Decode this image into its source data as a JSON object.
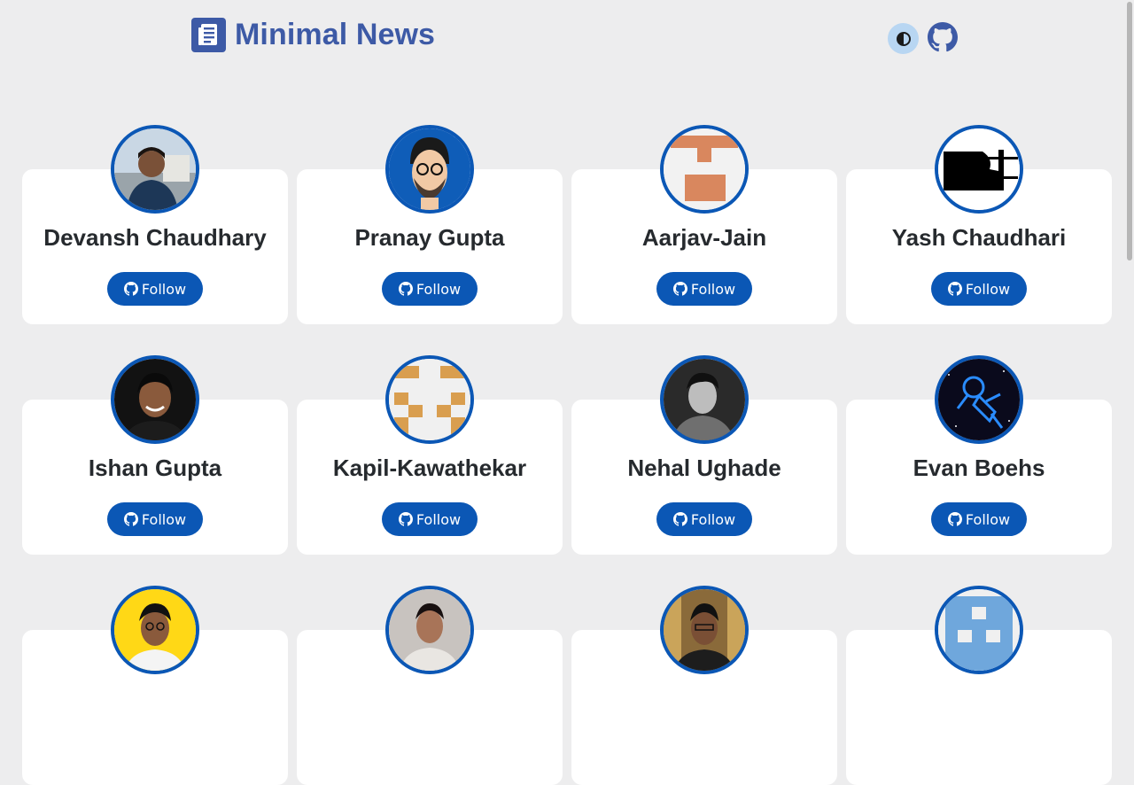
{
  "header": {
    "title": "Minimal News",
    "logo_icon": "newspaper-icon",
    "theme_toggle_icon": "contrast-icon",
    "github_icon": "github-icon"
  },
  "colors": {
    "brand": "#3d5aa6",
    "button": "#0b57b5",
    "avatar_border": "#0b57b5",
    "background": "#ededee",
    "card": "#ffffff",
    "name_text": "#262a2e"
  },
  "contributors": [
    {
      "name": "Devansh Chaudhary",
      "button_label": "Follow"
    },
    {
      "name": "Pranay Gupta",
      "button_label": "Follow"
    },
    {
      "name": "Aarjav-Jain",
      "button_label": "Follow"
    },
    {
      "name": "Yash Chaudhari",
      "button_label": "Follow"
    },
    {
      "name": "Ishan Gupta",
      "button_label": "Follow"
    },
    {
      "name": "Kapil-Kawathekar",
      "button_label": "Follow"
    },
    {
      "name": "Nehal Ughade",
      "button_label": "Follow"
    },
    {
      "name": "Evan Boehs",
      "button_label": "Follow"
    },
    {
      "name": "",
      "button_label": ""
    },
    {
      "name": "",
      "button_label": ""
    },
    {
      "name": "",
      "button_label": ""
    },
    {
      "name": "",
      "button_label": ""
    }
  ]
}
